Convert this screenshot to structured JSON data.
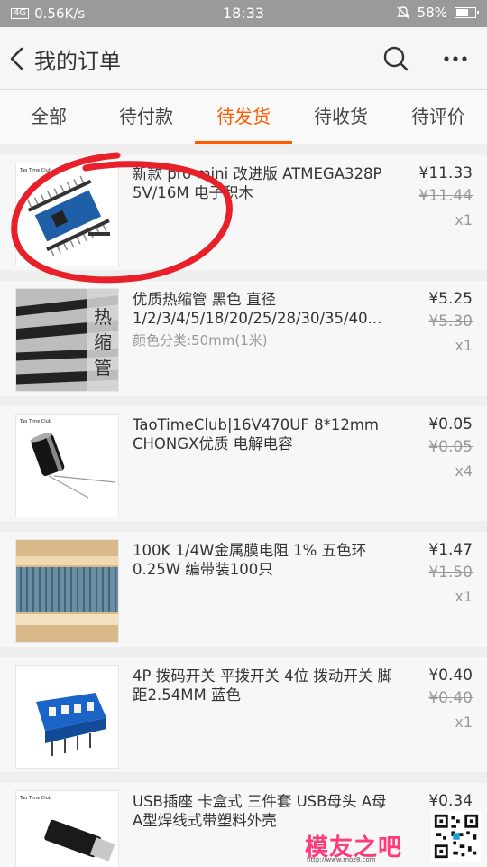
{
  "status": {
    "network": "4G",
    "speed": "0.56K/s",
    "time": "18:33",
    "battery": "58%",
    "battery_level": 0.58
  },
  "nav": {
    "title": "我的订单",
    "back_icon": "chevron-left-icon",
    "search_icon": "search-icon",
    "more_icon": "more-icon"
  },
  "tabs": [
    {
      "label": "全部"
    },
    {
      "label": "待付款"
    },
    {
      "label": "待发货",
      "active": true
    },
    {
      "label": "待收货"
    },
    {
      "label": "待评价"
    }
  ],
  "items": [
    {
      "title": "新款 pro mini 改进版 ATMEGA328P 5V/16M 电子积木",
      "spec": "",
      "price": "¥11.33",
      "orig": "¥11.44",
      "qty": "x1"
    },
    {
      "title": "优质热缩管 黑色 直径 1/2/3/4/5/18/20/25/28/30/35/40...",
      "spec": "颜色分类:50mm(1米)",
      "price": "¥5.25",
      "orig": "¥5.30",
      "qty": "x1"
    },
    {
      "title": "TaoTimeClub|16V470UF 8*12mm CHONGX优质 电解电容",
      "spec": "",
      "price": "¥0.05",
      "orig": "¥0.05",
      "qty": "x4"
    },
    {
      "title": "100K 1/4W金属膜电阻 1% 五色环 0.25W 编带装100只",
      "spec": "",
      "price": "¥1.47",
      "orig": "¥1.50",
      "qty": "x1"
    },
    {
      "title": "4P 拨码开关 平拨开关 4位 拨动开关 脚距2.54MM 蓝色",
      "spec": "",
      "price": "¥0.40",
      "orig": "¥0.40",
      "qty": "x1"
    },
    {
      "title": "USB插座 卡盒式 三件套 USB母头 A母 A型焊线式带塑料外壳",
      "spec": "",
      "price": "¥0.34",
      "orig": "",
      "qty": ""
    }
  ],
  "watermark": {
    "text": "模友之吧",
    "url": "http://www.moz8.com"
  },
  "colors": {
    "accent": "#ff5a00",
    "annotation": "#e8202a"
  }
}
